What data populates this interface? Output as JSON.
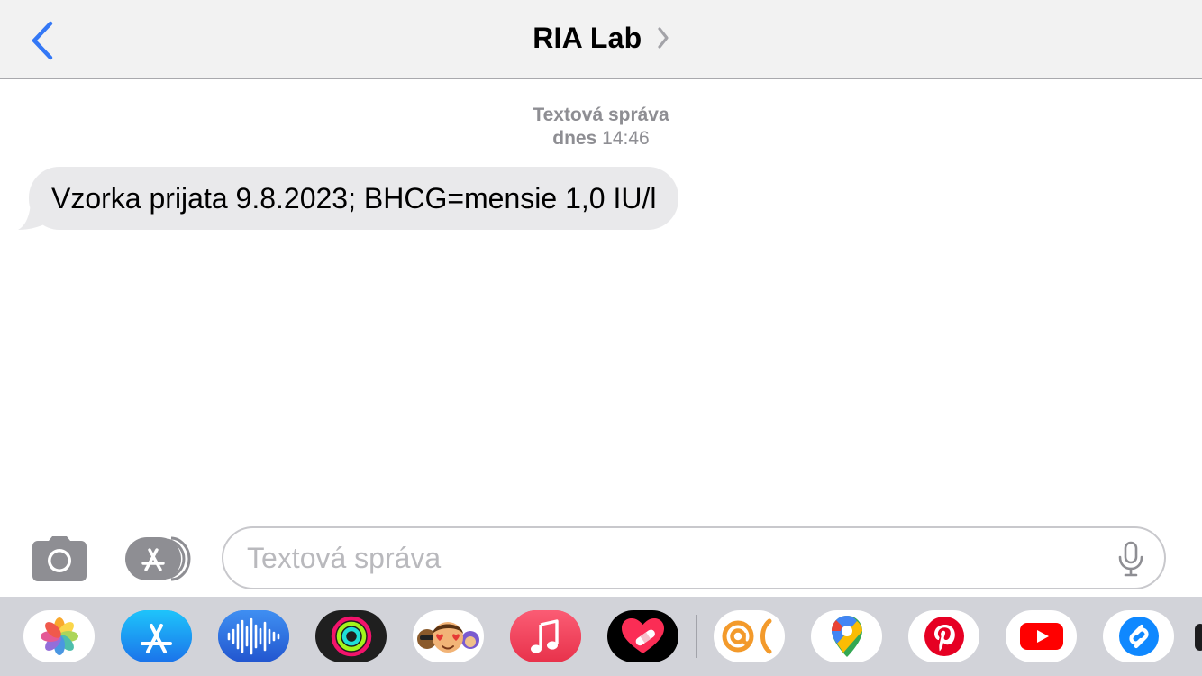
{
  "header": {
    "contact_name": "RIA Lab"
  },
  "thread": {
    "timestamp_label": "Textová správa",
    "timestamp_day": "dnes",
    "timestamp_time": "14:46",
    "messages": [
      {
        "direction": "incoming",
        "text": "Vzorka prijata 9.8.2023; BHCG=mensie 1,0 IU/l"
      }
    ]
  },
  "composer": {
    "placeholder": "Textová správa",
    "value": ""
  },
  "app_drawer": {
    "apps": [
      {
        "icon": "photos-icon"
      },
      {
        "icon": "app-store-icon"
      },
      {
        "icon": "voice-memos-icon"
      },
      {
        "icon": "activity-icon"
      },
      {
        "icon": "memoji-stickers-icon"
      },
      {
        "icon": "music-icon"
      },
      {
        "icon": "digital-touch-icon"
      },
      {
        "icon": "at-mention-app-icon"
      },
      {
        "icon": "google-maps-icon"
      },
      {
        "icon": "pinterest-icon"
      },
      {
        "icon": "youtube-icon"
      },
      {
        "icon": "shazam-icon"
      }
    ]
  },
  "colors": {
    "accent": "#3478f6",
    "bubble_incoming": "#e9e9eb",
    "header_bg": "#f2f2f2",
    "drawer_bg": "#d2d3d9",
    "secondary_text": "#8e8e93"
  }
}
